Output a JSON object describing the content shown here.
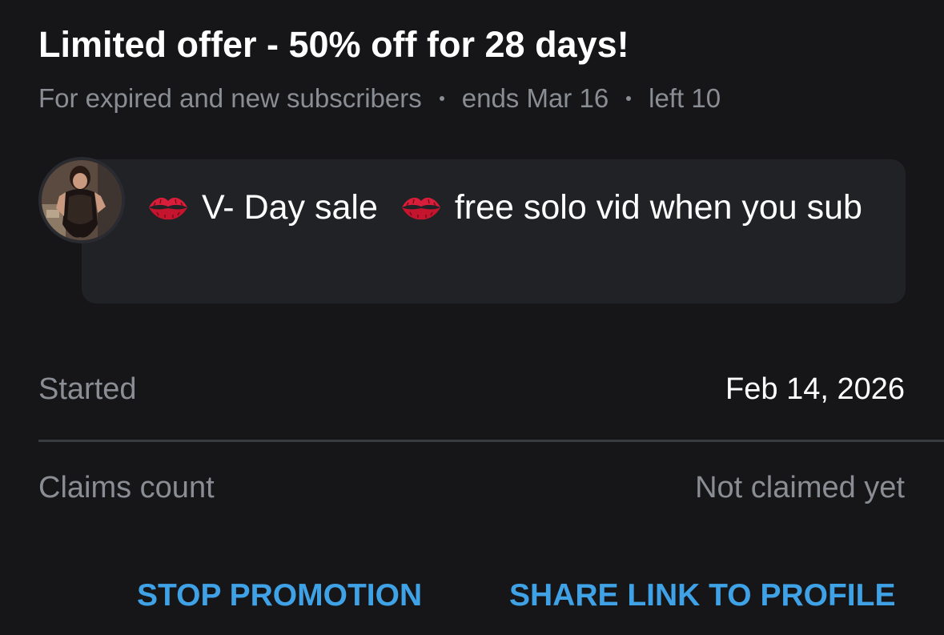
{
  "promo": {
    "title": "Limited offer - 50% off for 28 days!",
    "audience": "For expired and new subscribers",
    "ends": "ends Mar 16",
    "left": "left 10"
  },
  "message": {
    "avatar_icon": "profile-photo",
    "emoji_icon": "kiss-mark-icon",
    "part1": "V- Day sale",
    "part2": "free solo vid when you sub"
  },
  "details": {
    "started_label": "Started",
    "started_value": "Feb 14, 2026",
    "claims_label": "Claims count",
    "claims_value": "Not claimed yet"
  },
  "actions": {
    "stop_label": "STOP PROMOTION",
    "share_label": "SHARE LINK TO PROFILE"
  },
  "colors": {
    "background": "#161618",
    "bubble": "#212226",
    "accent": "#3fa2e6",
    "muted": "#8a8d93"
  }
}
